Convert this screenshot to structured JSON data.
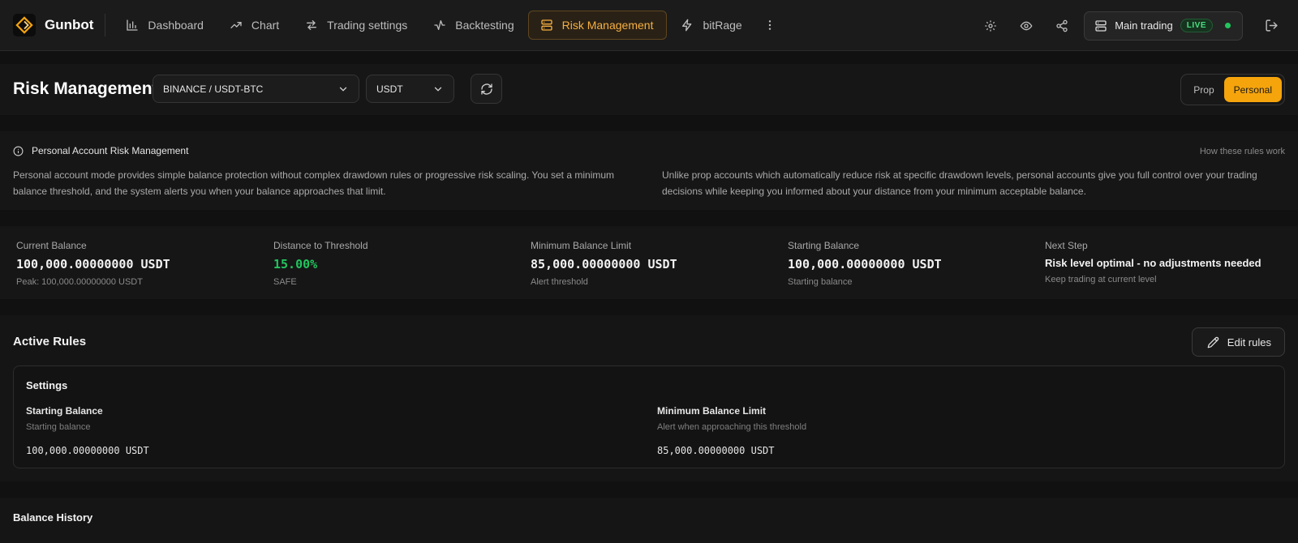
{
  "brand": {
    "name": "Gunbot"
  },
  "nav": {
    "items": [
      {
        "label": "Dashboard",
        "icon": "bar-chart-icon"
      },
      {
        "label": "Chart",
        "icon": "trend-icon"
      },
      {
        "label": "Trading settings",
        "icon": "arrows-icon"
      },
      {
        "label": "Backtesting",
        "icon": "activity-icon"
      },
      {
        "label": "Risk Management",
        "icon": "server-icon",
        "active": true
      },
      {
        "label": "bitRage",
        "icon": "zap-icon"
      }
    ]
  },
  "account": {
    "name": "Main trading",
    "badge": "LIVE",
    "status_color": "#22c55e"
  },
  "header": {
    "title": "Risk Management",
    "pair_select": "BINANCE / USDT-BTC",
    "currency_select": "USDT",
    "modes": [
      "Prop",
      "Personal"
    ],
    "active_mode": "Personal"
  },
  "info": {
    "title": "Personal Account Risk Management",
    "link": "How these rules work",
    "text_left": "Personal account mode provides simple balance protection without complex drawdown rules or progressive risk scaling. You set a minimum balance threshold, and the system alerts you when your balance approaches that limit.",
    "text_right": "Unlike prop accounts which automatically reduce risk at specific drawdown levels, personal accounts give you full control over your trading decisions while keeping you informed about your distance from your minimum acceptable balance."
  },
  "stats": [
    {
      "label": "Current Balance",
      "value": "100,000.00000000 USDT",
      "sub": "Peak: 100,000.00000000 USDT"
    },
    {
      "label": "Distance to Threshold",
      "value": "15.00%",
      "sub": "SAFE"
    },
    {
      "label": "Minimum Balance Limit",
      "value": "85,000.00000000 USDT",
      "sub": "Alert threshold"
    },
    {
      "label": "Starting Balance",
      "value": "100,000.00000000 USDT",
      "sub": "Starting balance"
    },
    {
      "label": "Next Step",
      "value": "Risk level optimal - no adjustments needed",
      "sub": "Keep trading at current level"
    }
  ],
  "rules": {
    "title": "Active Rules",
    "edit_label": "Edit rules",
    "card_title": "Settings",
    "settings": [
      {
        "label": "Starting Balance",
        "desc": "Starting balance",
        "value": "100,000.00000000 USDT"
      },
      {
        "label": "Minimum Balance Limit",
        "desc": "Alert when approaching this threshold",
        "value": "85,000.00000000 USDT"
      }
    ]
  },
  "history": {
    "title": "Balance History"
  },
  "colors": {
    "accent": "#f5a40c",
    "safe": "#22c55e",
    "background": "#111111"
  }
}
